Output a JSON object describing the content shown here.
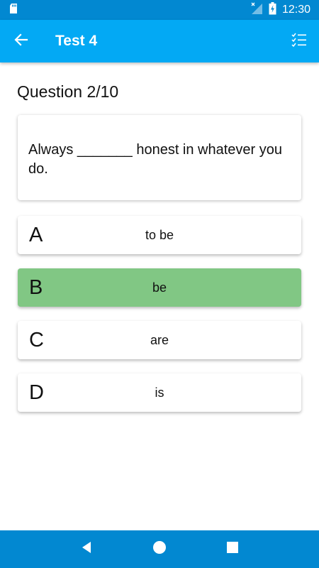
{
  "status_bar": {
    "time": "12:30",
    "icons": [
      "sd-card-icon",
      "no-signal-icon",
      "battery-charging-icon"
    ]
  },
  "app_bar": {
    "title": "Test 4",
    "icons": [
      "back-arrow-icon",
      "checklist-icon"
    ]
  },
  "question": {
    "heading": "Question 2/10",
    "text": "Always _______ honest in whatever you do."
  },
  "options": [
    {
      "letter": "A",
      "text": "to be",
      "selected": false
    },
    {
      "letter": "B",
      "text": "be",
      "selected": true
    },
    {
      "letter": "C",
      "text": "are",
      "selected": false
    },
    {
      "letter": "D",
      "text": "is",
      "selected": false
    }
  ],
  "nav_bar": {
    "icons": [
      "back-triangle-icon",
      "home-circle-icon",
      "recents-square-icon"
    ]
  },
  "colors": {
    "status_bar": "#0288d1",
    "app_bar": "#03a9f4",
    "selected_option": "#81c784",
    "nav_bar": "#0288d1"
  }
}
